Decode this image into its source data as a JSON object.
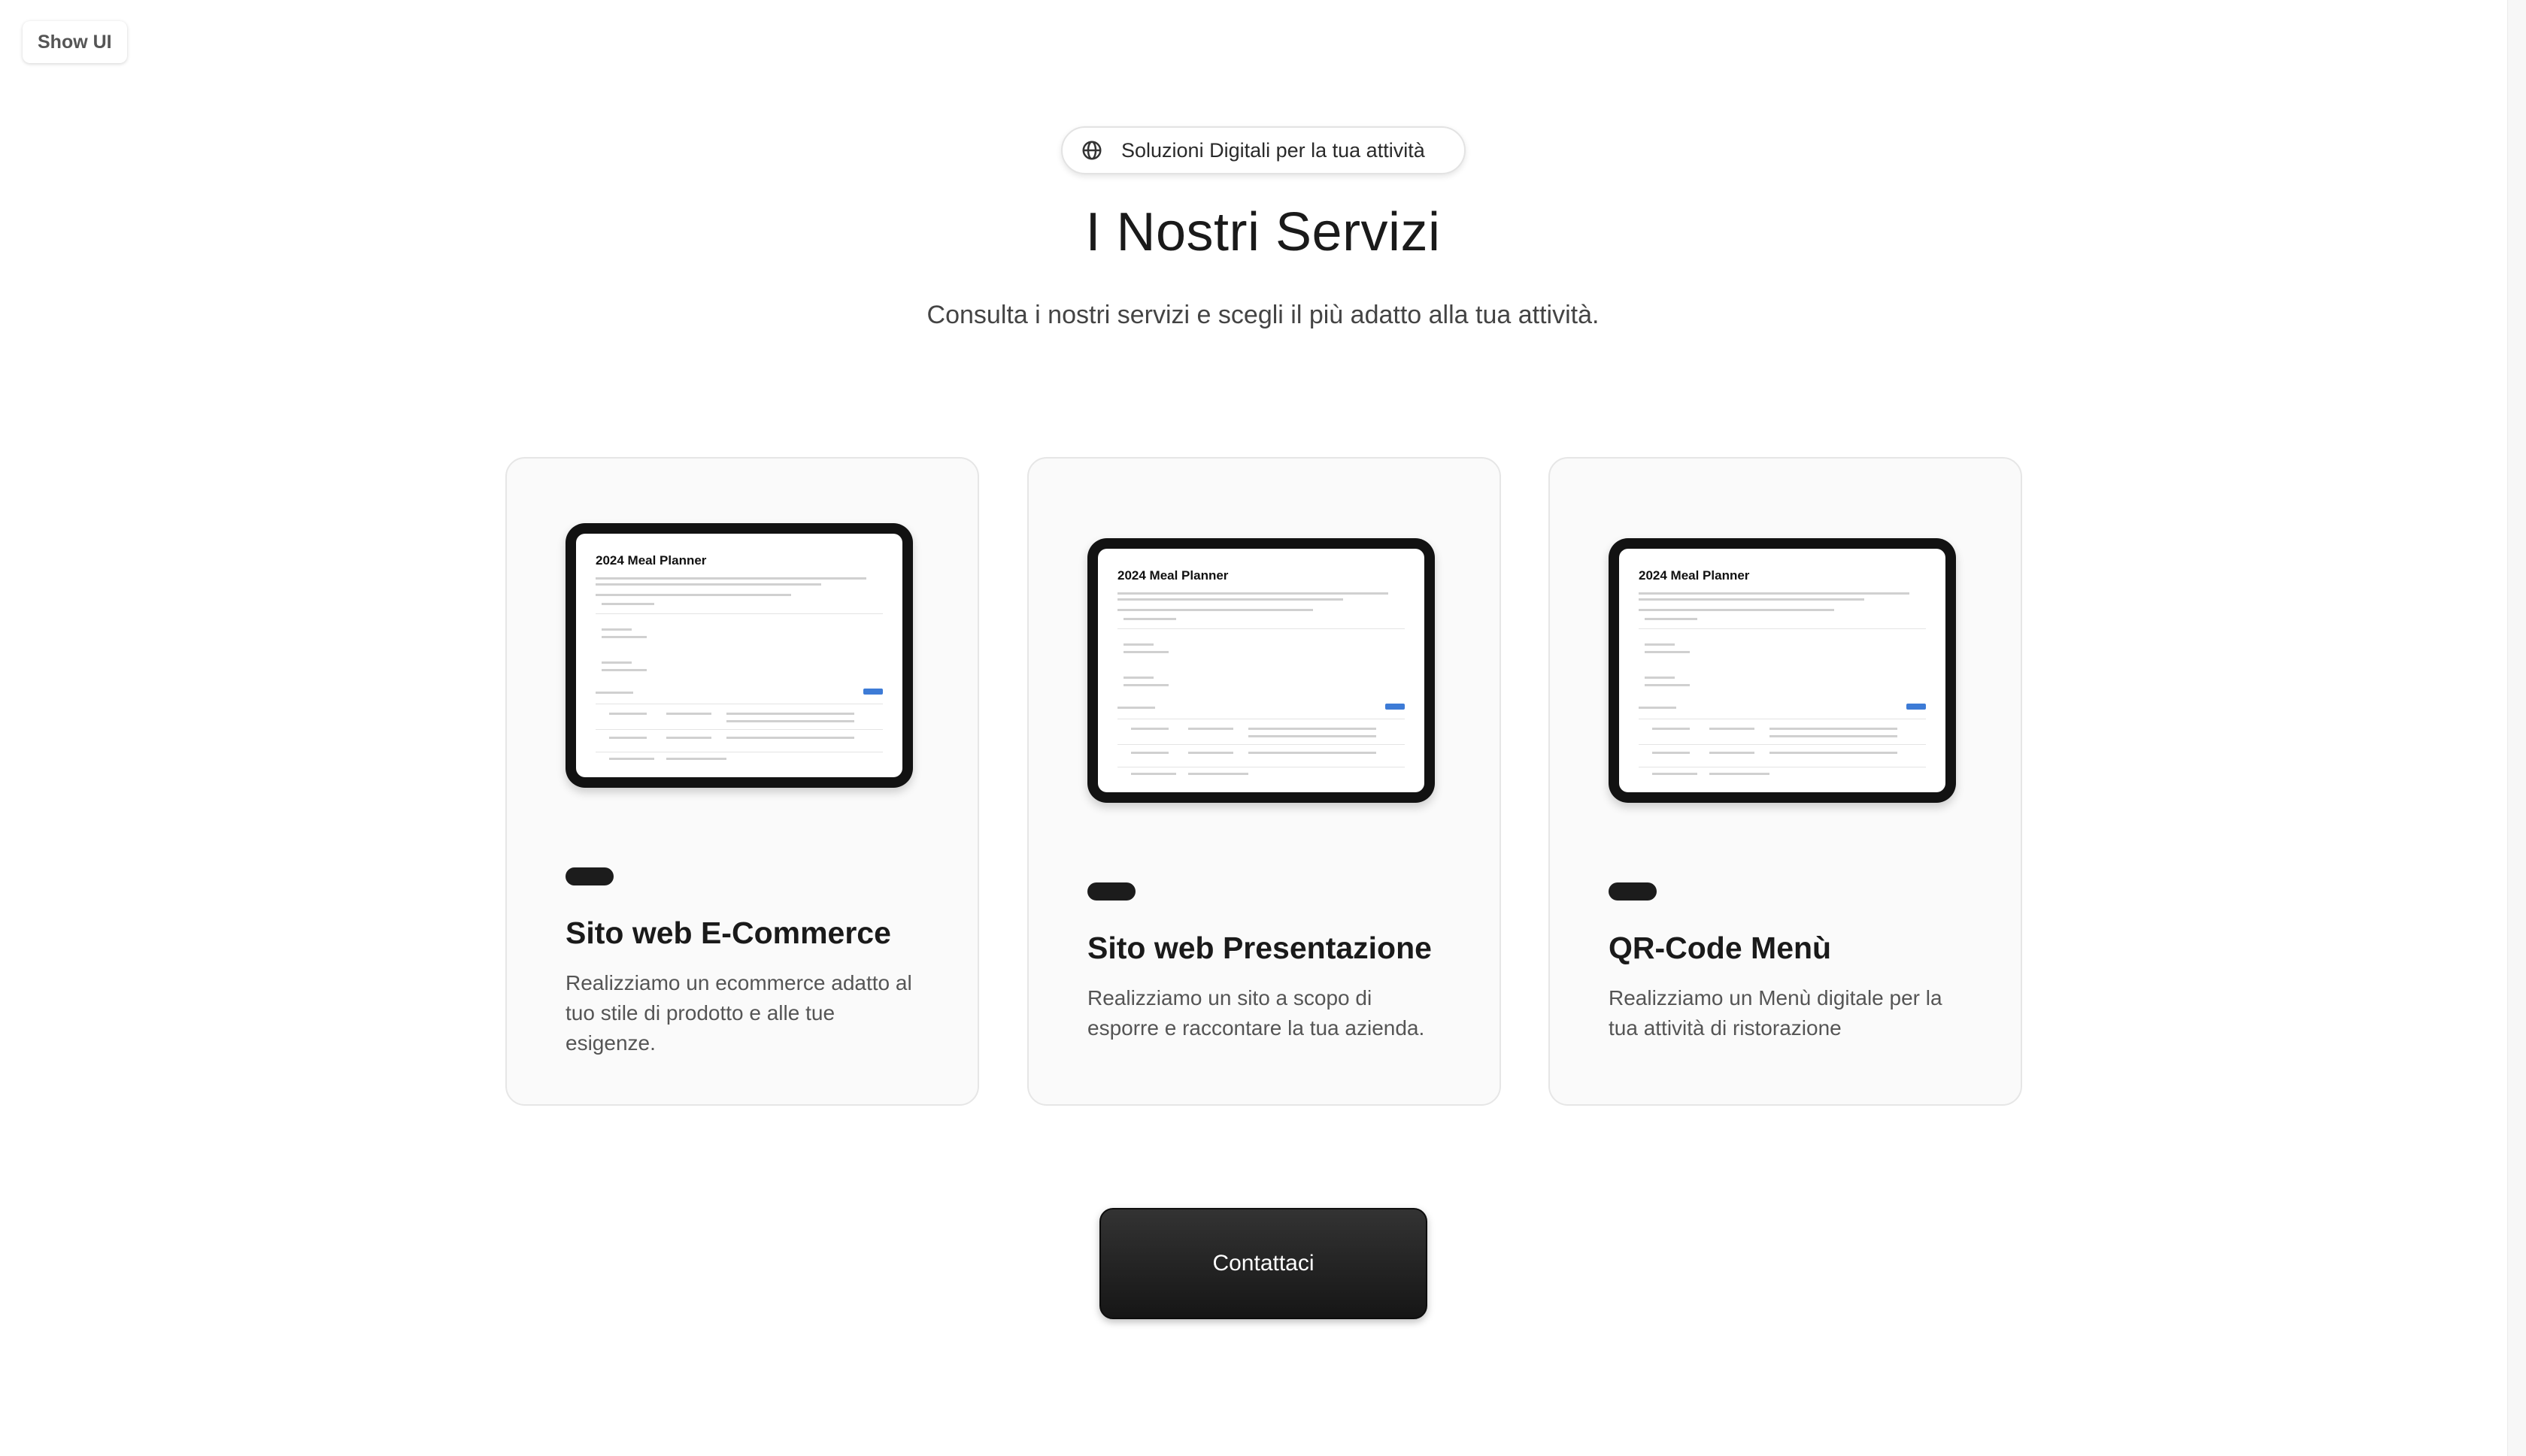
{
  "toolbar": {
    "show_ui_label": "Show UI"
  },
  "hero": {
    "badge_text": "Soluzioni Digitali per la tua attività",
    "title": "I Nostri Servizi",
    "subtitle": "Consulta i nostri servizi e scegli il più adatto alla tua attività."
  },
  "services": [
    {
      "title": "Sito web E-Commerce",
      "description": "Realizziamo un ecommerce adatto al tuo stile di prodotto e alle tue esigenze.",
      "image_title": "2024 Meal Planner"
    },
    {
      "title": "Sito web Presentazione",
      "description": "Realizziamo un sito a scopo di esporre e raccontare la tua azienda.",
      "image_title": "2024 Meal Planner"
    },
    {
      "title": "QR-Code Menù",
      "description": "Realizziamo un Menù digitale per la tua attività di ristorazione",
      "image_title": "2024 Meal Planner"
    }
  ],
  "cta": {
    "label": "Contattaci"
  }
}
